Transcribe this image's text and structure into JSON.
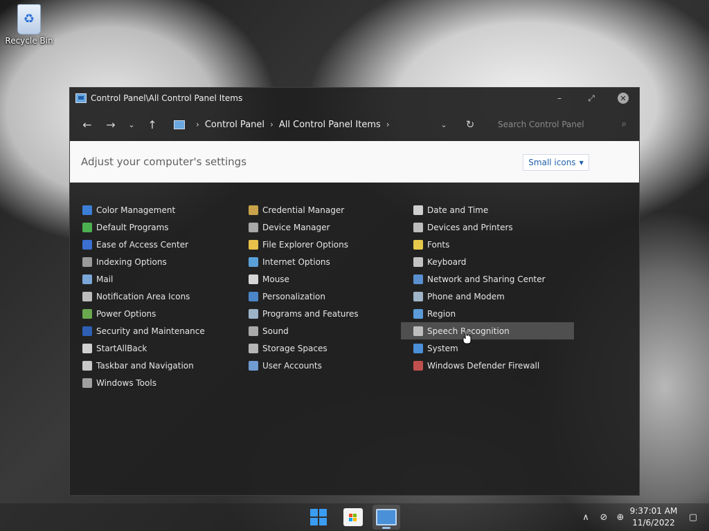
{
  "desktop": {
    "recycle_bin_label": "Recycle Bin"
  },
  "window": {
    "title": "Control Panel\\All Control Panel Items",
    "controls": {
      "minimize": "–",
      "maximize": "⤢",
      "close": "✕"
    }
  },
  "navbar": {
    "back": "←",
    "forward": "→",
    "recent": "⌄",
    "up": "↑",
    "breadcrumbs": [
      "Control Panel",
      "All Control Panel Items"
    ],
    "separator": "›",
    "dropdown": "⌄",
    "refresh": "↻",
    "search_placeholder": "Search Control Panel",
    "search_icon": "⌕"
  },
  "header": {
    "heading": "Adjust your computer's settings",
    "view_by_value": "Small icons",
    "view_by_arrow": "▼"
  },
  "items": {
    "col1": [
      {
        "label": "Color Management",
        "icon": "color-management-icon",
        "color": "#3c7ed6"
      },
      {
        "label": "Default Programs",
        "icon": "default-programs-icon",
        "color": "#4caf50"
      },
      {
        "label": "Ease of Access Center",
        "icon": "ease-of-access-icon",
        "color": "#3b6fd1"
      },
      {
        "label": "Indexing Options",
        "icon": "indexing-options-icon",
        "color": "#9a9a9a"
      },
      {
        "label": "Mail",
        "icon": "mail-icon",
        "color": "#7aa7d8"
      },
      {
        "label": "Notification Area Icons",
        "icon": "notification-area-icon",
        "color": "#bdbdbd"
      },
      {
        "label": "Power Options",
        "icon": "power-options-icon",
        "color": "#6aa84f"
      },
      {
        "label": "Security and Maintenance",
        "icon": "flag-icon",
        "color": "#2f5fb5"
      },
      {
        "label": "StartAllBack",
        "icon": "startallback-icon",
        "color": "#d0d0d0"
      },
      {
        "label": "Taskbar and Navigation",
        "icon": "taskbar-icon",
        "color": "#c9c9c9"
      },
      {
        "label": "Windows Tools",
        "icon": "windows-tools-icon",
        "color": "#a0a0a0"
      }
    ],
    "col2": [
      {
        "label": "Credential Manager",
        "icon": "credential-manager-icon",
        "color": "#c9a24a"
      },
      {
        "label": "Device Manager",
        "icon": "device-manager-icon",
        "color": "#a8a8a8"
      },
      {
        "label": "File Explorer Options",
        "icon": "folder-icon",
        "color": "#e8c04a"
      },
      {
        "label": "Internet Options",
        "icon": "internet-options-icon",
        "color": "#5aa0d8"
      },
      {
        "label": "Mouse",
        "icon": "mouse-icon",
        "color": "#d6d6d6"
      },
      {
        "label": "Personalization",
        "icon": "personalization-icon",
        "color": "#4a86c8"
      },
      {
        "label": "Programs and Features",
        "icon": "programs-features-icon",
        "color": "#9db3c8"
      },
      {
        "label": "Sound",
        "icon": "speaker-icon",
        "color": "#a9a9a9"
      },
      {
        "label": "Storage Spaces",
        "icon": "storage-spaces-icon",
        "color": "#b5b5b5"
      },
      {
        "label": "User Accounts",
        "icon": "user-accounts-icon",
        "color": "#6e9bd1"
      }
    ],
    "col3": [
      {
        "label": "Date and Time",
        "icon": "date-time-icon",
        "color": "#cfcfcf"
      },
      {
        "label": "Devices and Printers",
        "icon": "printer-icon",
        "color": "#bdbdbd"
      },
      {
        "label": "Fonts",
        "icon": "fonts-icon",
        "color": "#e6c84a"
      },
      {
        "label": "Keyboard",
        "icon": "keyboard-icon",
        "color": "#c2c2c2"
      },
      {
        "label": "Network and Sharing Center",
        "icon": "network-icon",
        "color": "#5a8fd0"
      },
      {
        "label": "Phone and Modem",
        "icon": "phone-modem-icon",
        "color": "#9fb4c9"
      },
      {
        "label": "Region",
        "icon": "globe-icon",
        "color": "#5b9bd8"
      },
      {
        "label": "Speech Recognition",
        "icon": "microphone-icon",
        "color": "#bdbdbd"
      },
      {
        "label": "System",
        "icon": "system-icon",
        "color": "#4a90d9"
      },
      {
        "label": "Windows Defender Firewall",
        "icon": "firewall-icon",
        "color": "#c0504d"
      }
    ]
  },
  "taskbar": {
    "time": "9:37:01 AM",
    "date": "11/6/2022",
    "tray_chevron": "∧",
    "tray_network": "⊘",
    "tray_globe": "⊕",
    "notification": "▢"
  }
}
